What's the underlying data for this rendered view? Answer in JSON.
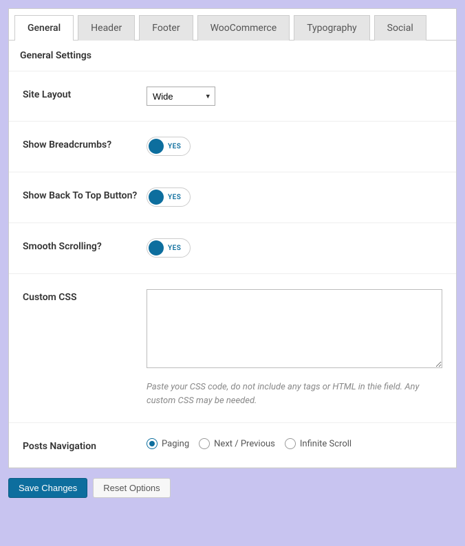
{
  "tabs": {
    "general": "General",
    "header": "Header",
    "footer": "Footer",
    "woocommerce": "WooCommerce",
    "typography": "Typography",
    "social": "Social"
  },
  "section_title": "General Settings",
  "fields": {
    "site_layout": {
      "label": "Site Layout",
      "value": "Wide"
    },
    "breadcrumbs": {
      "label": "Show Breadcrumbs?",
      "toggle_text": "YES"
    },
    "back_to_top": {
      "label": "Show Back To Top Button?",
      "toggle_text": "YES"
    },
    "smooth_scrolling": {
      "label": "Smooth Scrolling?",
      "toggle_text": "YES"
    },
    "custom_css": {
      "label": "Custom CSS",
      "value": "",
      "help": "Paste your CSS code, do not include any tags or HTML in thie field. Any custom CSS may be needed."
    },
    "posts_navigation": {
      "label": "Posts Navigation",
      "options": {
        "paging": "Paging",
        "next_prev": "Next / Previous",
        "infinite": "Infinite Scroll"
      }
    }
  },
  "actions": {
    "save": "Save Changes",
    "reset": "Reset Options"
  }
}
